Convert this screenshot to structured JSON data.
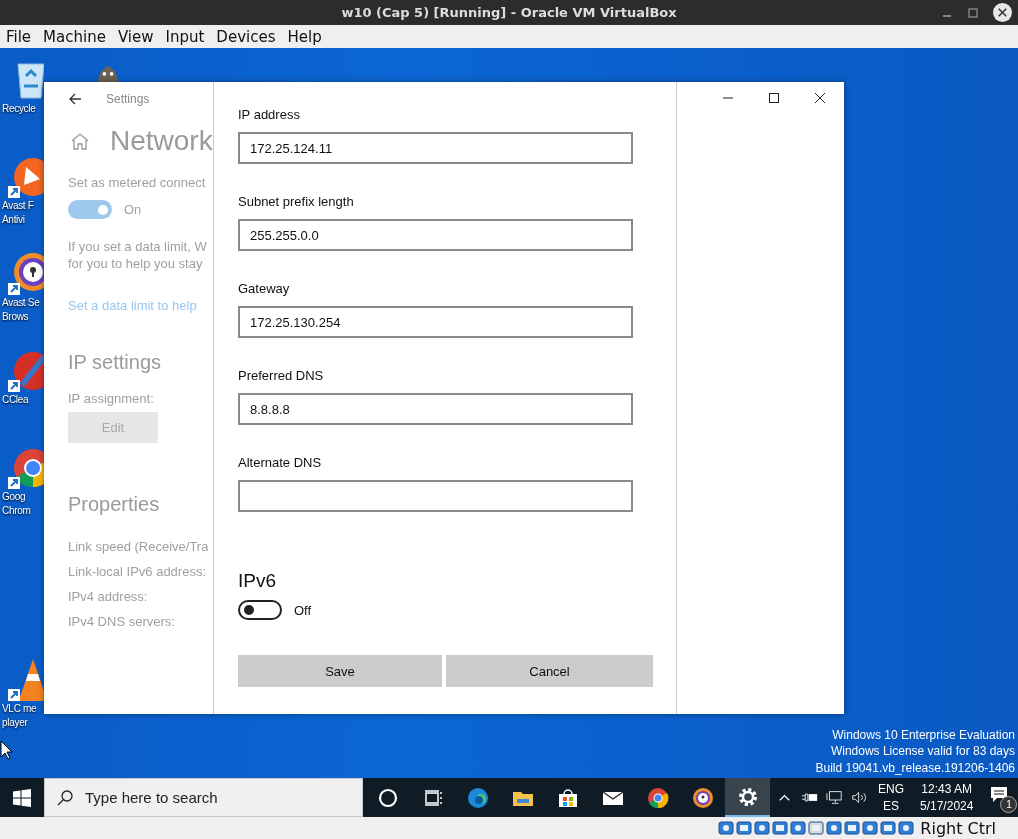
{
  "vm_window": {
    "title": "w10 (Cap 5) [Running] - Oracle VM VirtualBox",
    "menu": [
      "File",
      "Machine",
      "View",
      "Input",
      "Devices",
      "Help"
    ]
  },
  "desktop": {
    "icons": [
      {
        "kind": "recycle",
        "lines": [
          "Recycle"
        ]
      },
      {
        "kind": "avast",
        "lines": [
          "Avast F",
          "Antivi"
        ]
      },
      {
        "kind": "avast-browser",
        "lines": [
          "Avast Se",
          "Brows"
        ]
      },
      {
        "kind": "ccleaner",
        "lines": [
          "CClea"
        ]
      },
      {
        "kind": "chrome",
        "lines": [
          "Goog",
          "Chrom"
        ]
      },
      {
        "kind": "vlc",
        "lines": [
          "VLC me",
          "player"
        ]
      }
    ],
    "watermark": [
      "Windows 10 Enterprise Evaluation",
      "Windows License valid for 83 days",
      "Build 19041.vb_release.191206-1406"
    ]
  },
  "settings_window": {
    "title": "Settings",
    "page_title": "Network",
    "metered": {
      "label": "Set as metered connect",
      "on": true,
      "state_label": "On"
    },
    "data_limit_text": [
      "If you set a data limit, W",
      "for you to help you stay"
    ],
    "data_limit_link": "Set a data limit to help",
    "ip_settings": {
      "heading": "IP settings",
      "assignment_label": "IP assignment:",
      "edit_button": "Edit"
    },
    "properties": {
      "heading": "Properties",
      "rows": [
        "Link speed (Receive/Tra",
        "Link-local IPv6 address:",
        "IPv4 address:",
        "IPv4 DNS servers:"
      ]
    }
  },
  "edit_ip_dialog": {
    "fields": [
      {
        "label": "IP address",
        "value": "172.25.124.11"
      },
      {
        "label": "Subnet prefix length",
        "value": "255.255.0.0"
      },
      {
        "label": "Gateway",
        "value": "172.25.130.254"
      },
      {
        "label": "Preferred DNS",
        "value": "8.8.8.8"
      },
      {
        "label": "Alternate DNS"
      }
    ],
    "ipv6": {
      "heading": "IPv6",
      "on": false,
      "state_label": "Off"
    },
    "buttons": [
      "Save",
      "Cancel"
    ]
  },
  "taskbar": {
    "search_placeholder": "Type here to search",
    "apps": [
      {
        "kind": "cortana",
        "selected": false
      },
      {
        "kind": "taskview",
        "selected": false
      },
      {
        "kind": "edge",
        "selected": false
      },
      {
        "kind": "explorer",
        "selected": false
      },
      {
        "kind": "store",
        "selected": false
      },
      {
        "kind": "mail",
        "selected": false
      },
      {
        "kind": "chrome",
        "selected": false
      },
      {
        "kind": "avast-browser",
        "selected": false
      },
      {
        "kind": "settings",
        "selected": true
      }
    ],
    "language": [
      "ENG",
      "ES"
    ],
    "time": "12:43 AM",
    "date": "5/17/2024",
    "notification_count": "1"
  },
  "status_bar": {
    "host_key": "Right Ctrl"
  }
}
